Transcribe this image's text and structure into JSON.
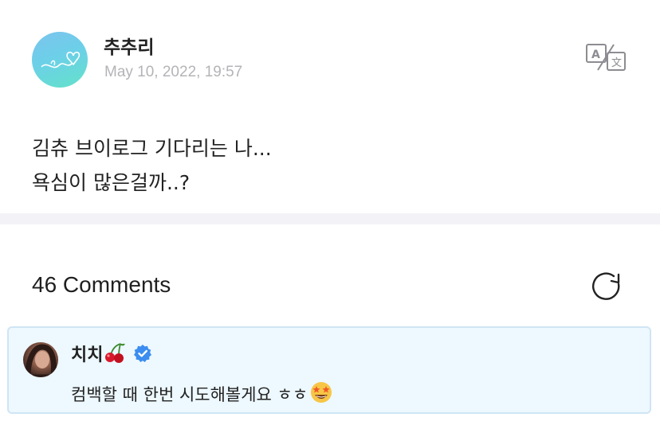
{
  "post": {
    "author": "추추리",
    "date": "May 10, 2022, 19:57",
    "translate_icon": "translate-icon",
    "body_lines": [
      "김츄 브이로그 기다리는 나...",
      "욕심이 많은걸까..?"
    ]
  },
  "comments": {
    "title": "46 Comments",
    "refresh_icon": "refresh-icon",
    "items": [
      {
        "author": "치치",
        "author_emoji": "cherry-icon",
        "verified_icon": "verified-check-icon",
        "text": "컴백할 때 한번 시도해볼게요 ㅎㅎ",
        "text_emoji": "star-struck-icon"
      }
    ]
  },
  "colors": {
    "date": "#b4b4b8",
    "divider": "#f3f3f7",
    "comment_bg": "#edf8ff",
    "comment_border": "#cfe5f4",
    "verified": "#3b8df0"
  }
}
